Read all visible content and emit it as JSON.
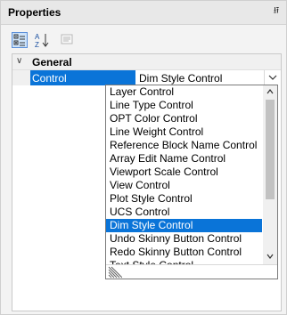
{
  "panel": {
    "title": "Properties",
    "collapse_glyph": "⭿"
  },
  "toolbar": {
    "buttons": [
      {
        "id": "categorized",
        "icon": "categorized-icon",
        "active": true
      },
      {
        "id": "alphabetical",
        "icon": "sort-az-icon",
        "active": false
      },
      {
        "id": "property-pages",
        "icon": "property-pages-icon",
        "active": false,
        "enabled": false
      }
    ]
  },
  "grid": {
    "category": {
      "expander_glyph": "∨",
      "label": "General"
    },
    "property": {
      "name": "Control",
      "value": "Dim Style Control"
    }
  },
  "dropdown": {
    "items": [
      "Layer Control",
      "Line Type Control",
      "OPT Color Control",
      "Line Weight Control",
      "Reference Block Name Control",
      "Array Edit Name Control",
      "Viewport Scale Control",
      "View Control",
      "Plot Style Control",
      "UCS Control",
      "Dim Style Control",
      "Undo Skinny Button Control",
      "Redo Skinny Button Control",
      "Text Style Control"
    ],
    "selected_index": 10
  },
  "colors": {
    "selection": "#0a74d8",
    "panel_bg": "#f3f3f3",
    "toolbar_active": "#cde3fa"
  }
}
